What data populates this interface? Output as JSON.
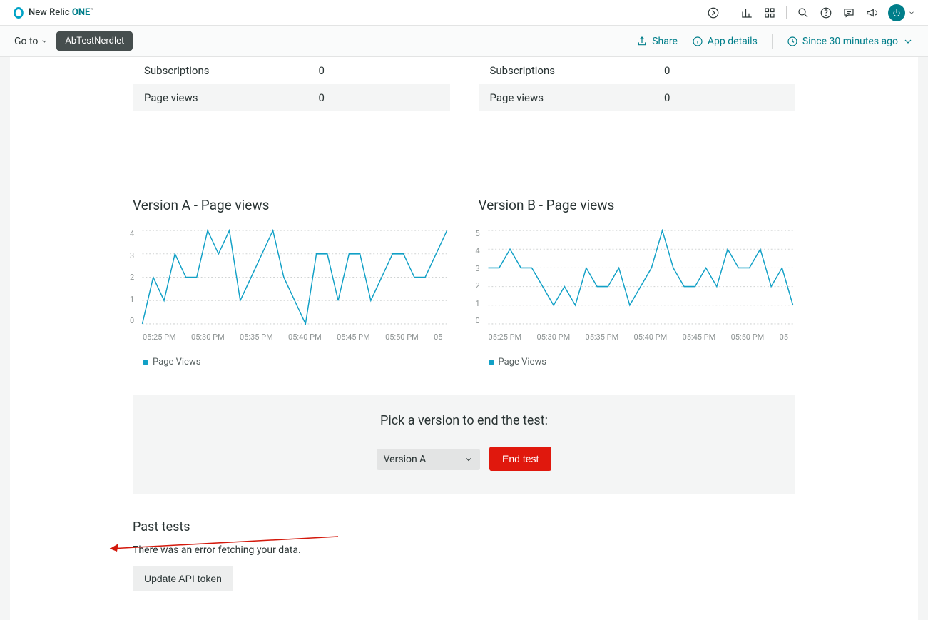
{
  "header": {
    "brand_prefix": "New Relic",
    "brand_suffix": "ONE",
    "brand_tm": "™"
  },
  "toolbar": {
    "goto_label": "Go to",
    "badge": "AbTestNerdlet",
    "share_label": "Share",
    "details_label": "App details",
    "time_label": "Since 30 minutes ago"
  },
  "tables": {
    "left": [
      {
        "label": "Subscriptions",
        "value": "0"
      },
      {
        "label": "Page views",
        "value": "0"
      }
    ],
    "right": [
      {
        "label": "Subscriptions",
        "value": "0"
      },
      {
        "label": "Page views",
        "value": "0"
      }
    ]
  },
  "charts_titles": {
    "a": "Version A - Page views",
    "b": "Version B - Page views"
  },
  "chart_data": [
    {
      "type": "line",
      "title": "Version A - Page views",
      "series": [
        {
          "name": "Page Views",
          "values": [
            0,
            2,
            1,
            3,
            2,
            2,
            4,
            3,
            4,
            1,
            2,
            3,
            4,
            2,
            1,
            0,
            3,
            3,
            1,
            3,
            3,
            1,
            2,
            3,
            3,
            2,
            2,
            3,
            4
          ]
        }
      ],
      "x_labels": [
        "05:25 PM",
        "05:30 PM",
        "05:35 PM",
        "05:40 PM",
        "05:45 PM",
        "05:50 PM",
        "05"
      ],
      "y_ticks": [
        0,
        1,
        2,
        3,
        4
      ],
      "ylim": [
        0,
        4
      ],
      "legend": "Page Views"
    },
    {
      "type": "line",
      "title": "Version B - Page views",
      "series": [
        {
          "name": "Page Views",
          "values": [
            3,
            3,
            4,
            3,
            3,
            2,
            1,
            2,
            1,
            3,
            2,
            2,
            3,
            1,
            2,
            3,
            5,
            3,
            2,
            2,
            3,
            2,
            4,
            3,
            3,
            4,
            2,
            3,
            1
          ]
        }
      ],
      "x_labels": [
        "05:25 PM",
        "05:30 PM",
        "05:35 PM",
        "05:40 PM",
        "05:45 PM",
        "05:50 PM",
        "05"
      ],
      "y_ticks": [
        0,
        1,
        2,
        3,
        4,
        5
      ],
      "ylim": [
        0,
        5
      ],
      "legend": "Page Views"
    }
  ],
  "end_test": {
    "heading": "Pick a version to end the test:",
    "selected": "Version A",
    "button": "End test"
  },
  "past_tests": {
    "heading": "Past tests",
    "error": "There was an error fetching your data.",
    "button": "Update API token"
  }
}
